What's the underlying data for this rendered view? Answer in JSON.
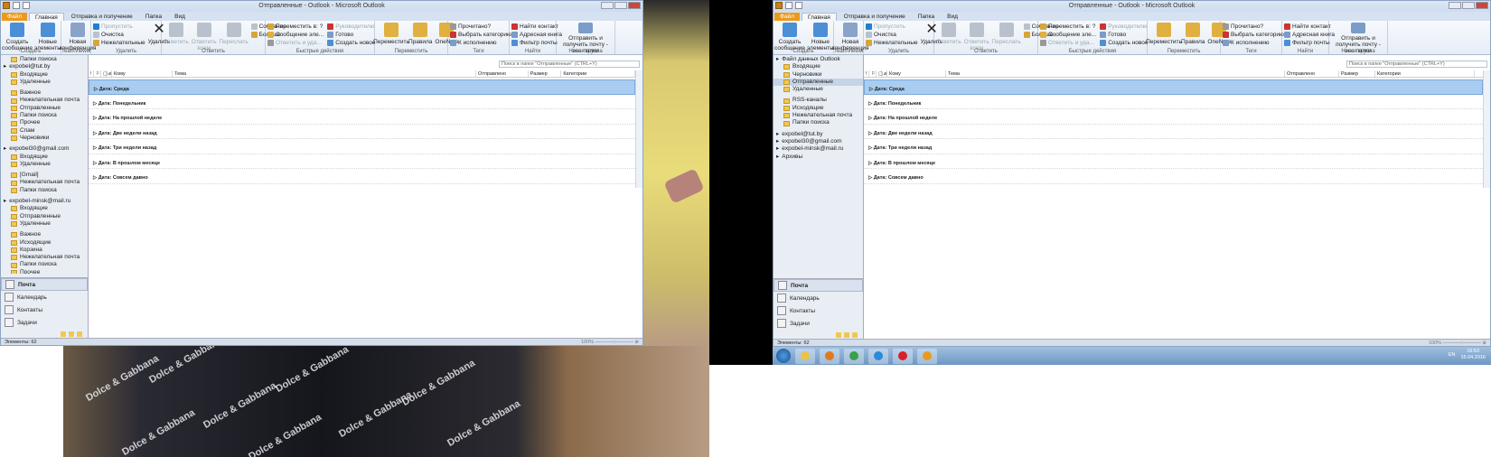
{
  "background": {
    "print_text": "Dolce & Gabbana"
  },
  "windows": [
    {
      "title": "Отправленные - Outlook - Microsoft Outlook",
      "tabs": [
        "Файл",
        "Главная",
        "Отправка и получение",
        "Папка",
        "Вид"
      ],
      "ribbon": [
        {
          "label": "Создать",
          "big": [
            "Создать сообщение",
            "Новые элементы"
          ],
          "small": []
        },
        {
          "label": "TeamViewer",
          "big": [
            "Новая конференция"
          ],
          "small": []
        },
        {
          "label": "Удалить",
          "big": [],
          "small": [
            "Пропустить",
            "Очистка",
            "Нежелательные"
          ],
          "big2": [
            "Удалить"
          ]
        },
        {
          "label": "Ответить",
          "big": [
            "Ответить",
            "Ответить всем",
            "Переслать"
          ],
          "small": [
            "Собрание",
            "Больше"
          ]
        },
        {
          "label": "Быстрые действия",
          "big": [],
          "small": [
            "Переместить в: ?",
            "Сообщение эле...",
            "Ответить и уда...",
            "Руководителю",
            "Готово",
            "Создать новое"
          ]
        },
        {
          "label": "Переместить",
          "big": [
            "Переместить",
            "Правила",
            "OneNote"
          ],
          "small": []
        },
        {
          "label": "Теги",
          "big": [],
          "small": [
            "Прочитано?",
            "Выбрать категорию",
            "К исполнению"
          ]
        },
        {
          "label": "Найти",
          "big": [],
          "small": [
            "Найти контакт",
            "Адресная книга",
            "Фильтр почты"
          ]
        },
        {
          "label": "Новая группа",
          "big": [
            "Отправить и получить почту - все папки"
          ],
          "small": []
        }
      ],
      "nav": [
        {
          "t": "f",
          "label": "Папки поиска"
        },
        {
          "t": "acc",
          "label": "expobel@tut.by"
        },
        {
          "t": "f",
          "label": "Входящие"
        },
        {
          "t": "f",
          "label": "Удаленные"
        },
        {
          "t": "gap"
        },
        {
          "t": "f",
          "label": "Важное"
        },
        {
          "t": "f",
          "label": "Нежелательная почта"
        },
        {
          "t": "f",
          "label": "Отправленные"
        },
        {
          "t": "f",
          "label": "Папки поиска"
        },
        {
          "t": "f",
          "label": "Прочее"
        },
        {
          "t": "f",
          "label": "Спам"
        },
        {
          "t": "f",
          "label": "Черновики"
        },
        {
          "t": "gap"
        },
        {
          "t": "acc",
          "label": "expobel30@gmail.com"
        },
        {
          "t": "f",
          "label": "Входящие"
        },
        {
          "t": "f",
          "label": "Удаленные"
        },
        {
          "t": "gap"
        },
        {
          "t": "f",
          "label": "[Gmail]"
        },
        {
          "t": "f",
          "label": "Нежелательная почта"
        },
        {
          "t": "f",
          "label": "Папки поиска"
        },
        {
          "t": "gap"
        },
        {
          "t": "acc",
          "label": "expobel-minsk@mail.ru"
        },
        {
          "t": "f",
          "label": "Входящие"
        },
        {
          "t": "f",
          "label": "Отправленные"
        },
        {
          "t": "f",
          "label": "Удаленные"
        },
        {
          "t": "gap"
        },
        {
          "t": "f",
          "label": "Важное"
        },
        {
          "t": "f",
          "label": "Исходящие"
        },
        {
          "t": "f",
          "label": "Корзина"
        },
        {
          "t": "f",
          "label": "Нежелательная почта"
        },
        {
          "t": "f",
          "label": "Папки поиска"
        },
        {
          "t": "f",
          "label": "Прочее"
        }
      ],
      "modules": [
        "Почта",
        "Календарь",
        "Контакты",
        "Задачи"
      ],
      "search_placeholder": "Поиск в папке \"Отправленные\" (CTRL+Y)",
      "columns": [
        "Кому",
        "Тема",
        "Отправлено",
        "Размер",
        "Категории"
      ],
      "groups": [
        "Дата: Среда",
        "Дата: Понедельник",
        "Дата: На прошлой неделе",
        "Дата: Две недели назад",
        "Дата: Три недели назад",
        "Дата: В прошлом месяце",
        "Дата: Совсем давно"
      ],
      "status": "Элементы: 62",
      "zoom": "100%"
    },
    {
      "title": "Отправленные - Outlook - Microsoft Outlook",
      "tabs": [
        "Файл",
        "Главная",
        "Отправка и получение",
        "Папка",
        "Вид"
      ],
      "ribbon": [
        {
          "label": "Создать",
          "big": [
            "Создать сообщение",
            "Новые элементы"
          ],
          "small": []
        },
        {
          "label": "TeamViewer",
          "big": [
            "Новая конференция"
          ],
          "small": []
        },
        {
          "label": "Удалить",
          "big": [],
          "small": [
            "Пропустить",
            "Очистка",
            "Нежелательные"
          ],
          "big2": [
            "Удалить"
          ]
        },
        {
          "label": "Ответить",
          "big": [
            "Ответить",
            "Ответить всем",
            "Переслать"
          ],
          "small": [
            "Собрание",
            "Больше"
          ]
        },
        {
          "label": "Быстрые действия",
          "big": [],
          "small": [
            "Переместить в: ?",
            "Сообщение эле...",
            "Ответить и уда...",
            "Руководителю",
            "Готово",
            "Создать новое"
          ]
        },
        {
          "label": "Переместить",
          "big": [
            "Переместить",
            "Правила",
            "OneNote"
          ],
          "small": []
        },
        {
          "label": "Теги",
          "big": [],
          "small": [
            "Прочитано?",
            "Выбрать категорию",
            "К исполнению"
          ]
        },
        {
          "label": "Найти",
          "big": [],
          "small": [
            "Найти контакт",
            "Адресная книга",
            "Фильтр почты"
          ]
        },
        {
          "label": "Новая группа",
          "big": [
            "Отправить и получить почту - все папки"
          ],
          "small": []
        }
      ],
      "nav": [
        {
          "t": "acc",
          "label": "Файл данных Outlook"
        },
        {
          "t": "f",
          "label": "Входящие"
        },
        {
          "t": "f",
          "label": "Черновики"
        },
        {
          "t": "f",
          "label": "Отправленные",
          "sel": true
        },
        {
          "t": "f",
          "label": "Удаленные"
        },
        {
          "t": "gap"
        },
        {
          "t": "f",
          "label": "RSS-каналы"
        },
        {
          "t": "f",
          "label": "Исходящие"
        },
        {
          "t": "f",
          "label": "Нежелательная почта"
        },
        {
          "t": "f",
          "label": "Папки поиска"
        },
        {
          "t": "gap"
        },
        {
          "t": "acc",
          "label": "expobel@tut.by"
        },
        {
          "t": "acc",
          "label": "expobel30@gmail.com"
        },
        {
          "t": "acc",
          "label": "expobel-minsk@mail.ru"
        },
        {
          "t": "acc",
          "label": "Архивы"
        }
      ],
      "modules": [
        "Почта",
        "Календарь",
        "Контакты",
        "Задачи"
      ],
      "search_placeholder": "Поиск в папке \"Отправленные\" (CTRL+Y)",
      "columns": [
        "Кому",
        "Тема",
        "Отправлено",
        "Размер",
        "Категории"
      ],
      "groups": [
        "Дата: Среда",
        "Дата: Понедельник",
        "Дата: На прошлой неделе",
        "Дата: Две недели назад",
        "Дата: Три недели назад",
        "Дата: В прошлом месяце",
        "Дата: Совсем давно"
      ],
      "status": "Элементы: 62",
      "zoom": "100%"
    }
  ],
  "taskbar": {
    "lang": "EN",
    "time": "16:53",
    "date": "15.04.2016",
    "apps": [
      "explorer",
      "media-player",
      "chrome",
      "internet-explorer",
      "opera",
      "outlook"
    ]
  }
}
